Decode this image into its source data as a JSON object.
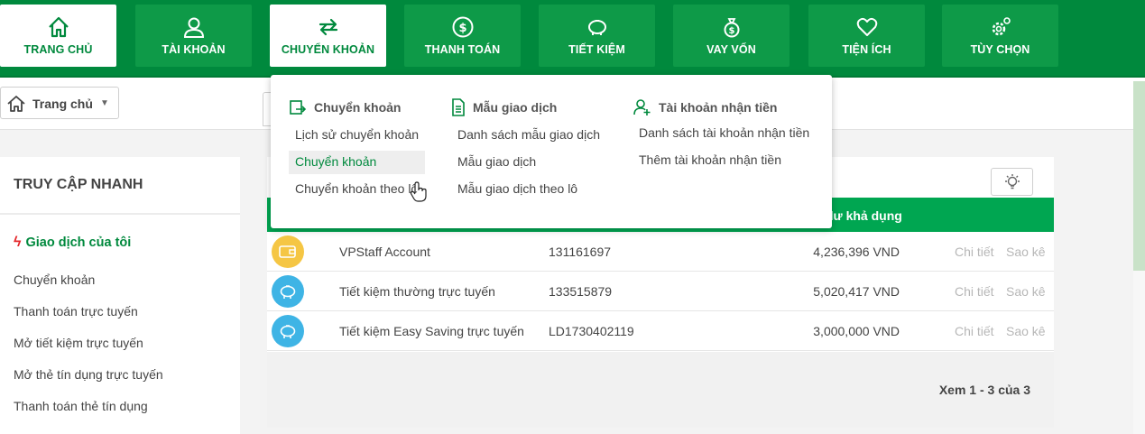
{
  "nav": {
    "items": [
      {
        "label": "TRANG CHỦ",
        "icon": "home-icon"
      },
      {
        "label": "TÀI KHOẢN",
        "icon": "user-icon"
      },
      {
        "label": "CHUYỂN KHOẢN",
        "icon": "transfer-icon"
      },
      {
        "label": "THANH TOÁN",
        "icon": "dollar-icon"
      },
      {
        "label": "TIẾT KIỆM",
        "icon": "piggy-bank-icon"
      },
      {
        "label": "VAY VỐN",
        "icon": "money-bag-icon"
      },
      {
        "label": "TIỆN ÍCH",
        "icon": "heart-icon"
      },
      {
        "label": "TÙY CHỌN",
        "icon": "gear-icon"
      }
    ]
  },
  "breadcrumb": {
    "label": "Trang chủ",
    "caret": "▼"
  },
  "dropdown": {
    "col1": {
      "title": "Chuyển khoản",
      "links": [
        "Lịch sử chuyển khoản",
        "Chuyển khoản",
        "Chuyển khoản theo lô"
      ]
    },
    "col2": {
      "title": "Mẫu giao dịch",
      "links": [
        "Danh sách mẫu giao dịch",
        "Mẫu giao dịch",
        "Mẫu giao dịch theo lô"
      ]
    },
    "col3": {
      "title": "Tài khoản nhận tiền",
      "links": [
        "Danh sách tài khoản nhận tiền",
        "Thêm tài khoản nhận tiền"
      ]
    }
  },
  "sidebar": {
    "title": "TRUY CẬP NHANH",
    "section": "Giao dịch của tôi",
    "items": [
      "Chuyển khoản",
      "Thanh toán trực tuyến",
      "Mở tiết kiệm trực tuyến",
      "Mở thẻ tín dụng trực tuyến",
      "Thanh toán thẻ tín dụng"
    ]
  },
  "table": {
    "balance_header": "dư khả dụng",
    "rows": [
      {
        "name": "VPStaff Account",
        "number": "131161697",
        "balance": "4,236,396 VND",
        "detail": "Chi tiết",
        "statement": "Sao kê",
        "icon": "wallet-icon"
      },
      {
        "name": "Tiết kiệm thường trực tuyến",
        "number": "133515879",
        "balance": "5,020,417 VND",
        "detail": "Chi tiết",
        "statement": "Sao kê",
        "icon": "piggy-bank-icon"
      },
      {
        "name": "Tiết kiệm Easy Saving trực tuyến",
        "number": "LD1730402119",
        "balance": "3,000,000 VND",
        "detail": "Chi tiết",
        "statement": "Sao kê",
        "icon": "piggy-bank-icon"
      }
    ],
    "pager": "Xem 1 - 3 của 3"
  },
  "colors": {
    "brand_green": "#00893d",
    "nav_button": "#0e9a48",
    "table_header": "#00a651",
    "wallet_avatar": "#f5c644",
    "piggy_avatar": "#3eb4e5",
    "alert_red": "#e4262a"
  }
}
